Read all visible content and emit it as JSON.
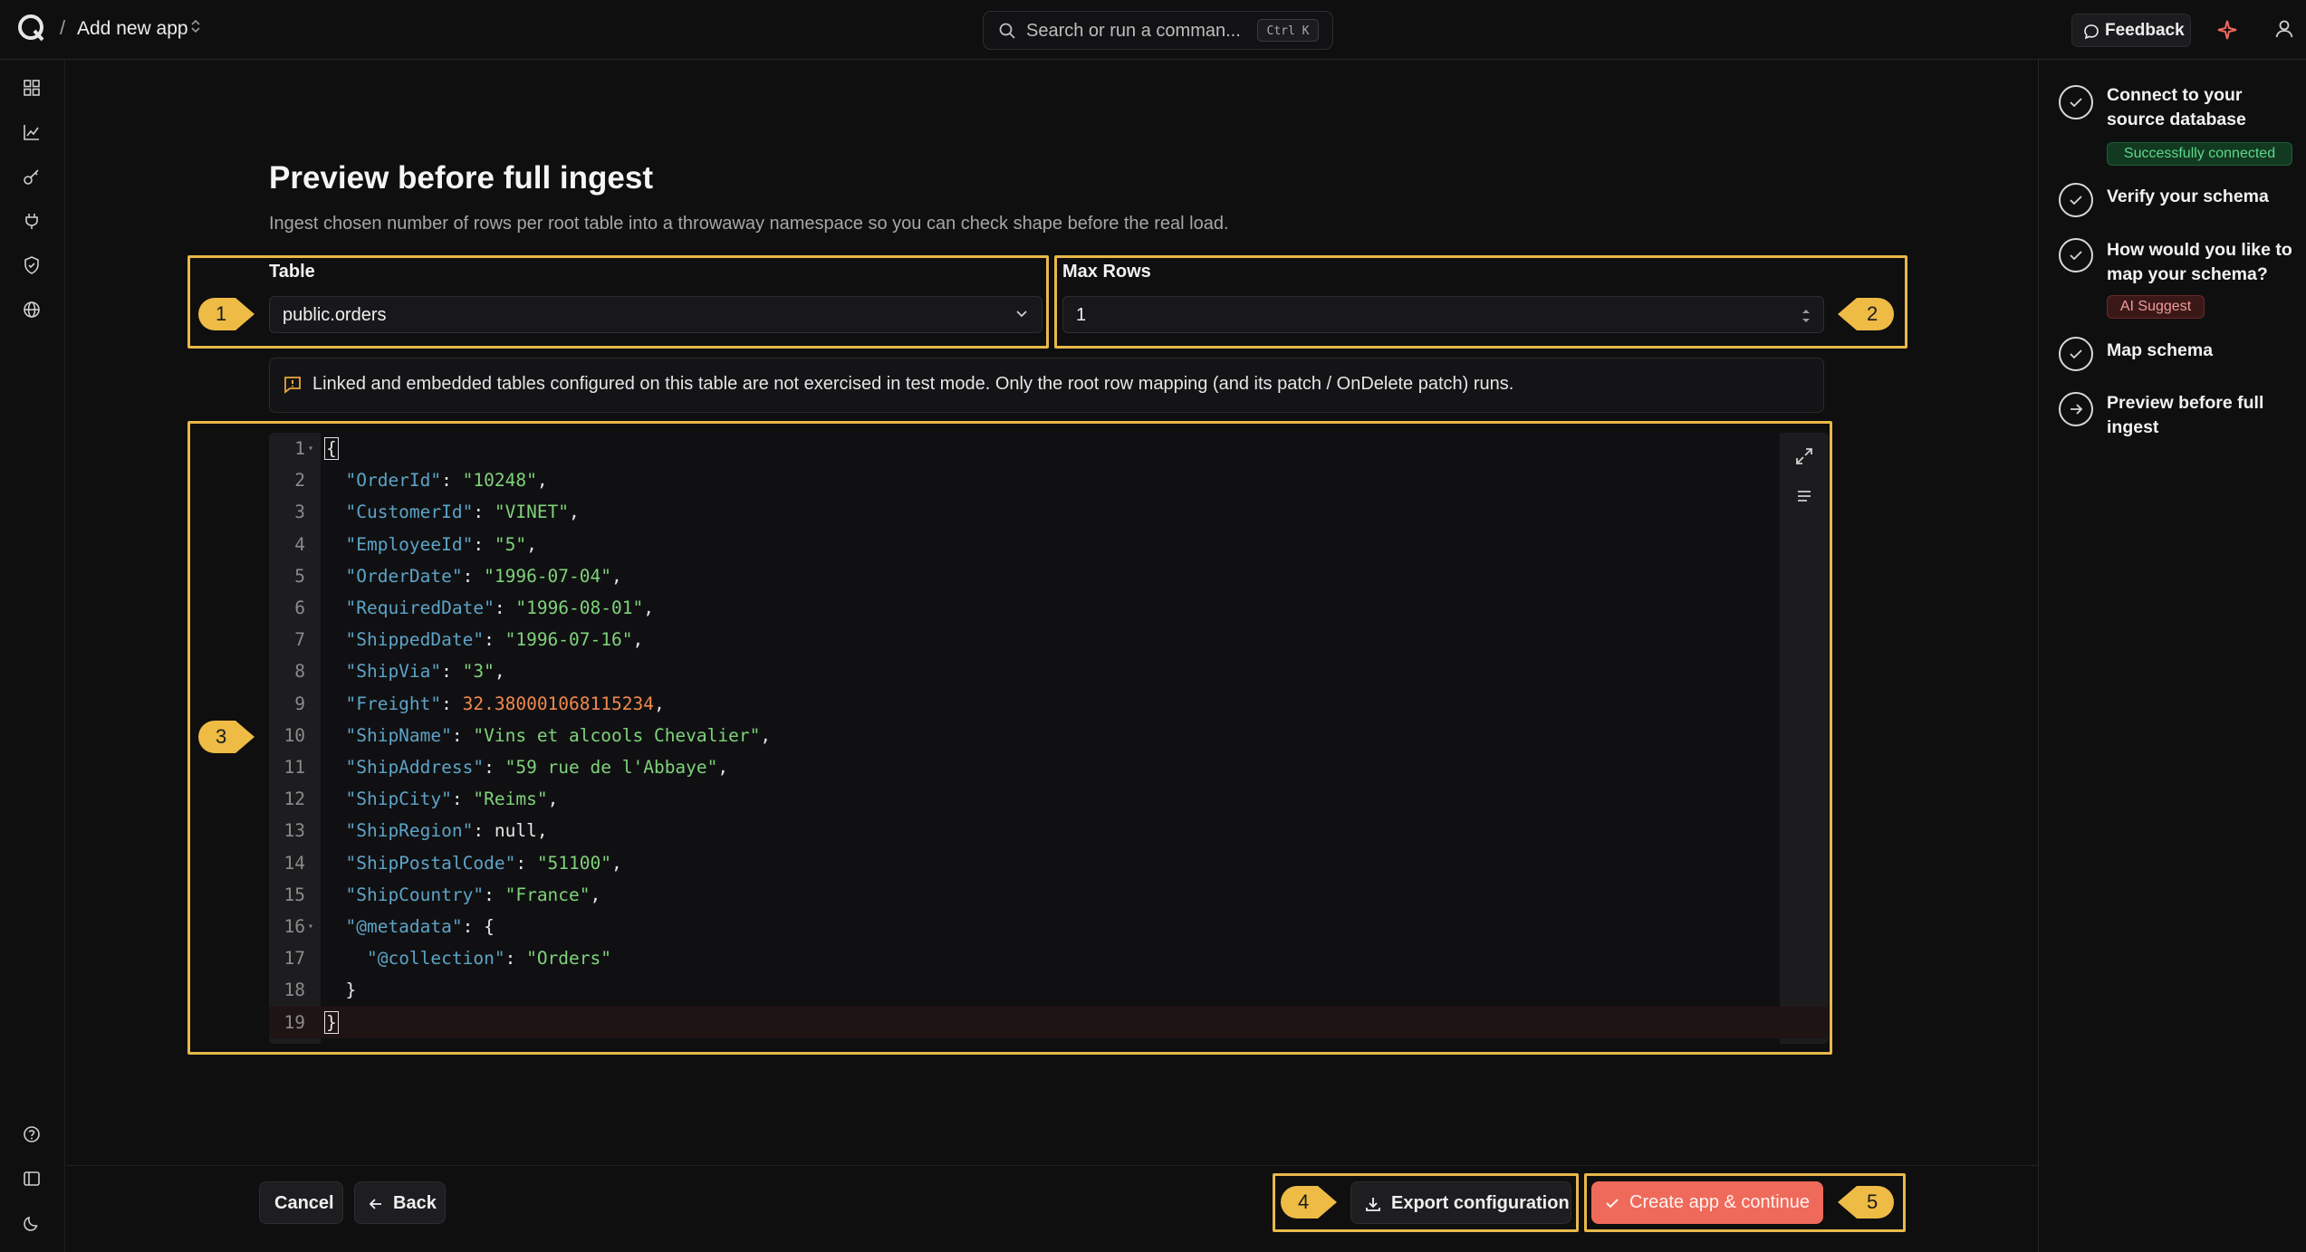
{
  "header": {
    "breadcrumb_separator": "/",
    "title": "Add new app",
    "search_placeholder": "Search or run a comman...",
    "search_shortcut": "Ctrl K",
    "feedback_label": "Feedback"
  },
  "page": {
    "title": "Preview before full ingest",
    "subtitle": "Ingest chosen number of rows per root table into a throwaway namespace so you can check shape before the real load."
  },
  "form": {
    "table_label": "Table",
    "table_value": "public.orders",
    "max_rows_label": "Max Rows",
    "max_rows_value": "1"
  },
  "notice": "Linked and embedded tables configured on this table are not exercised in test mode. Only the root row mapping (and its patch / OnDelete patch) runs.",
  "editor": {
    "lines": [
      {
        "n": "1",
        "fold": true,
        "text": "{"
      },
      {
        "n": "2",
        "key": "\"OrderId\"",
        "val": "\"10248\"",
        "type": "s",
        "comma": ","
      },
      {
        "n": "3",
        "key": "\"CustomerId\"",
        "val": "\"VINET\"",
        "type": "s",
        "comma": ","
      },
      {
        "n": "4",
        "key": "\"EmployeeId\"",
        "val": "\"5\"",
        "type": "s",
        "comma": ","
      },
      {
        "n": "5",
        "key": "\"OrderDate\"",
        "val": "\"1996-07-04\"",
        "type": "s",
        "comma": ","
      },
      {
        "n": "6",
        "key": "\"RequiredDate\"",
        "val": "\"1996-08-01\"",
        "type": "s",
        "comma": ","
      },
      {
        "n": "7",
        "key": "\"ShippedDate\"",
        "val": "\"1996-07-16\"",
        "type": "s",
        "comma": ","
      },
      {
        "n": "8",
        "key": "\"ShipVia\"",
        "val": "\"3\"",
        "type": "s",
        "comma": ","
      },
      {
        "n": "9",
        "key": "\"Freight\"",
        "val": "32.380001068115234",
        "type": "n",
        "comma": ","
      },
      {
        "n": "10",
        "key": "\"ShipName\"",
        "val": "\"Vins et alcools Chevalier\"",
        "type": "s",
        "comma": ","
      },
      {
        "n": "11",
        "key": "\"ShipAddress\"",
        "val": "\"59 rue de l'Abbaye\"",
        "type": "s",
        "comma": ","
      },
      {
        "n": "12",
        "key": "\"ShipCity\"",
        "val": "\"Reims\"",
        "type": "s",
        "comma": ","
      },
      {
        "n": "13",
        "key": "\"ShipRegion\"",
        "val": "null",
        "type": "p",
        "comma": ","
      },
      {
        "n": "14",
        "key": "\"ShipPostalCode\"",
        "val": "\"51100\"",
        "type": "s",
        "comma": ","
      },
      {
        "n": "15",
        "key": "\"ShipCountry\"",
        "val": "\"France\"",
        "type": "s",
        "comma": ","
      },
      {
        "n": "16",
        "fold": true,
        "key": "\"@metadata\"",
        "val": "{",
        "type": "p",
        "comma": ""
      },
      {
        "n": "17",
        "indent": 2,
        "key": "\"@collection\"",
        "val": "\"Orders\"",
        "type": "s",
        "comma": ""
      },
      {
        "n": "18",
        "text": "  }"
      },
      {
        "n": "19",
        "text": "}",
        "last": true
      }
    ]
  },
  "footer": {
    "cancel_label": "Cancel",
    "back_label": "Back",
    "export_label": "Export configuration",
    "create_label": "Create app & continue"
  },
  "annotations": [
    "1",
    "2",
    "3",
    "4",
    "5"
  ],
  "steps": [
    {
      "label": "Connect to your source database",
      "badge": "Successfully connected",
      "badge_kind": "green",
      "icon": "check-icon"
    },
    {
      "label": "Verify your schema",
      "icon": "check-icon"
    },
    {
      "label": "How would you like to map your schema?",
      "badge": "AI Suggest",
      "badge_kind": "red",
      "icon": "check-icon"
    },
    {
      "label": "Map schema",
      "icon": "check-icon"
    },
    {
      "label": "Preview before full ingest",
      "icon": "arrow-right-icon"
    }
  ],
  "colors": {
    "accent": "#ef6a5a",
    "highlight": "#e8b84a",
    "json_key": "#5da3c7",
    "json_string": "#7fd27a",
    "json_number": "#f0894f"
  }
}
